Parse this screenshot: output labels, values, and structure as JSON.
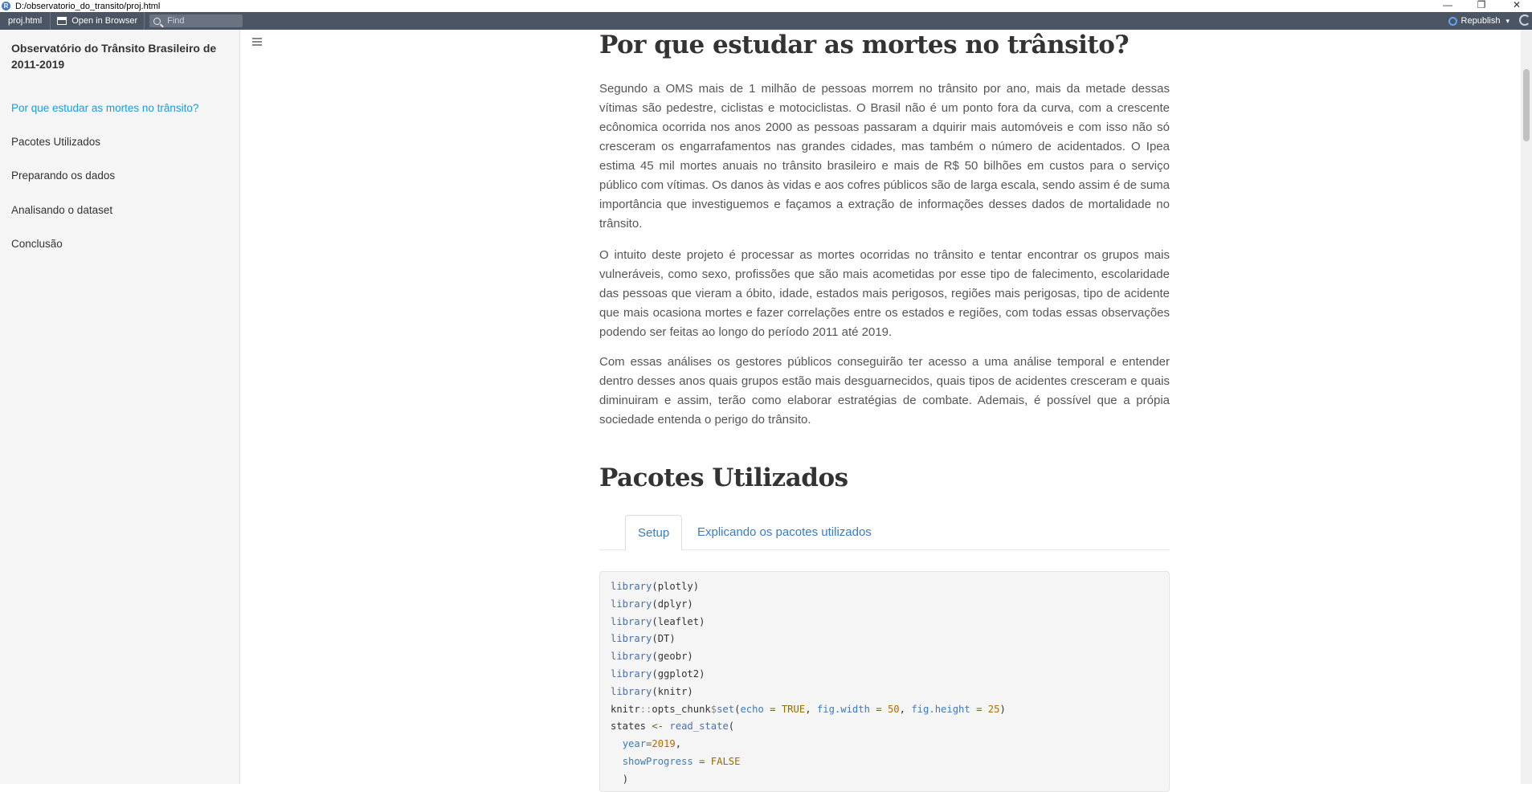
{
  "window": {
    "path": "D:/observatorio_do_transito/proj.html",
    "logo_letter": "R",
    "minimize_glyph": "—",
    "restore_glyph": "❐",
    "close_glyph": "✕"
  },
  "toolbar": {
    "file_tab": "proj.html",
    "open_browser_label": "Open in Browser",
    "find_placeholder": "Find",
    "republish_label": "Republish",
    "republish_caret": "▾"
  },
  "sidebar": {
    "title": "Observatório do Trânsito Brasileiro de 2011-2019",
    "items": [
      {
        "label": "Por que estudar as mortes no trânsito?",
        "active": true
      },
      {
        "label": "Pacotes Utilizados"
      },
      {
        "label": "Preparando os dados"
      },
      {
        "label": "Analisando o dataset"
      },
      {
        "label": "Conclusão"
      }
    ]
  },
  "section1": {
    "title": "Por que estudar as mortes no trânsito?",
    "paragraphs": [
      "Segundo a OMS mais de 1 milhão de pessoas morrem no trânsito por ano, mais da metade dessas vítimas são pedestre, ciclistas e motociclistas. O Brasil não é um ponto fora da curva, com a crescente ecônomica ocorrida nos anos 2000 as pessoas passaram a dquirir mais automóveis e com isso não só cresceram os engarrafamentos nas grandes cidades, mas também o número de acidentados. O Ipea estima 45 mil mortes anuais no trânsito brasileiro e mais de R$ 50 bilhões em custos para o serviço público com vítimas. Os danos às vidas e aos cofres públicos são de larga escala, sendo assim é de suma importância que investiguemos e façamos a extração de informações desses dados de mortalidade no trânsito.",
      "O intuito deste projeto é processar as mortes ocorridas no trânsito e tentar encontrar os grupos mais vulneráveis, como sexo, profissões que são mais acometidas por esse tipo de falecimento, escolaridade das pessoas que vieram a óbito, idade, estados mais perigosos, regiões mais perigosas, tipo de acidente que mais ocasiona mortes e fazer correlações entre os estados e regiões, com todas essas observações podendo ser feitas ao longo do período 2011 até 2019.",
      "Com essas análises os gestores públicos conseguirão ter acesso a uma análise temporal e entender dentro desses anos quais grupos estão mais desguarnecidos, quais tipos de acidentes cresceram e quais diminuiram e assim, terão como elaborar estratégias de combate. Ademais, é possível que a própia sociedade entenda o perigo do trânsito."
    ]
  },
  "section2": {
    "title": "Pacotes Utilizados",
    "tabs": [
      {
        "label": "Setup",
        "active": true
      },
      {
        "label": "Explicando os pacotes utilizados"
      }
    ],
    "code": {
      "library_fn": "library",
      "packages": [
        "plotly",
        "dplyr",
        "leaflet",
        "DT",
        "geobr",
        "ggplot2",
        "knitr"
      ],
      "knitr_ns": "knitr",
      "ns_op": "::",
      "opts_chunk": "opts_chunk",
      "dollar": "$",
      "set_fn": "set",
      "echo_arg": "echo",
      "true_kw": "TRUE",
      "fig_width_arg": "fig.width",
      "fig_width_val": "50",
      "fig_height_arg": "fig.height",
      "fig_height_val": "25",
      "states_var": "states",
      "assign_op": "<-",
      "read_state_fn": "read_state",
      "year_arg": "year",
      "year_val": "2019",
      "showprogress_arg": "showProgress",
      "false_kw": "FALSE",
      "close_paren": ")"
    }
  }
}
